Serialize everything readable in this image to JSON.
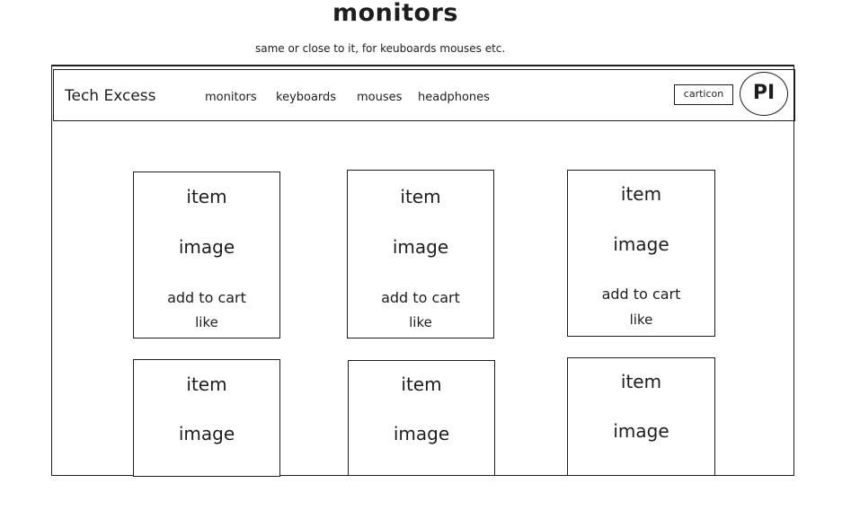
{
  "page": {
    "title": "monitors",
    "subtitle": "same or close to it, for keuboards mouses etc."
  },
  "header": {
    "brand": "Tech Excess",
    "nav": [
      "monitors",
      "keyboards",
      "mouses",
      "headphones"
    ],
    "cart_label": "carticon",
    "avatar_initials": "PI"
  },
  "cards_row1": [
    {
      "item": "item",
      "image": "image",
      "add_to_cart": "add to cart",
      "like": "like"
    },
    {
      "item": "item",
      "image": "image",
      "add_to_cart": "add to cart",
      "like": "like"
    },
    {
      "item": "item",
      "image": "image",
      "add_to_cart": "add to cart",
      "like": "like"
    }
  ],
  "cards_row2": [
    {
      "item": "item",
      "image": "image"
    },
    {
      "item": "item",
      "image": "image"
    },
    {
      "item": "item",
      "image": "image"
    }
  ]
}
